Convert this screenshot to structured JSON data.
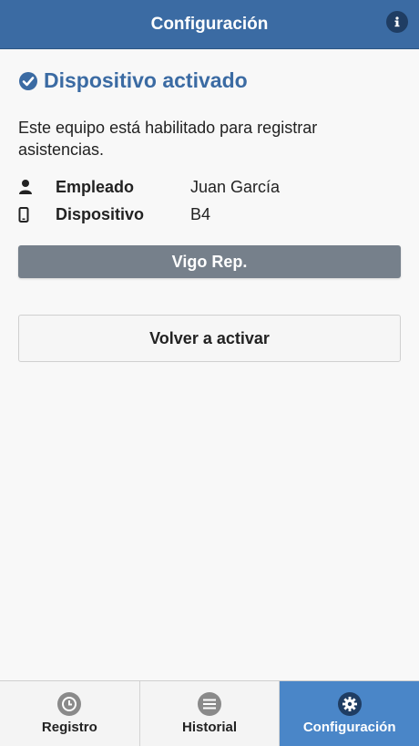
{
  "header": {
    "title": "Configuración"
  },
  "status": {
    "title": "Dispositivo activado"
  },
  "description": "Este equipo está habilitado para registrar asistencias.",
  "info": [
    {
      "icon": "user-icon",
      "label": "Empleado",
      "value": "Juan García"
    },
    {
      "icon": "mobile-icon",
      "label": "Dispositivo",
      "value": "B4"
    }
  ],
  "group_button": "Vigo Rep.",
  "reactivate_button": "Volver a activar",
  "tabs": [
    {
      "label": "Registro",
      "icon": "clock-icon",
      "active": false
    },
    {
      "label": "Historial",
      "icon": "list-icon",
      "active": false
    },
    {
      "label": "Configuración",
      "icon": "gear-icon",
      "active": true
    }
  ],
  "colors": {
    "header": "#3b6ba3",
    "accent": "#3b6ba3",
    "group_button": "#76808b",
    "active_tab": "#4a86c8"
  }
}
